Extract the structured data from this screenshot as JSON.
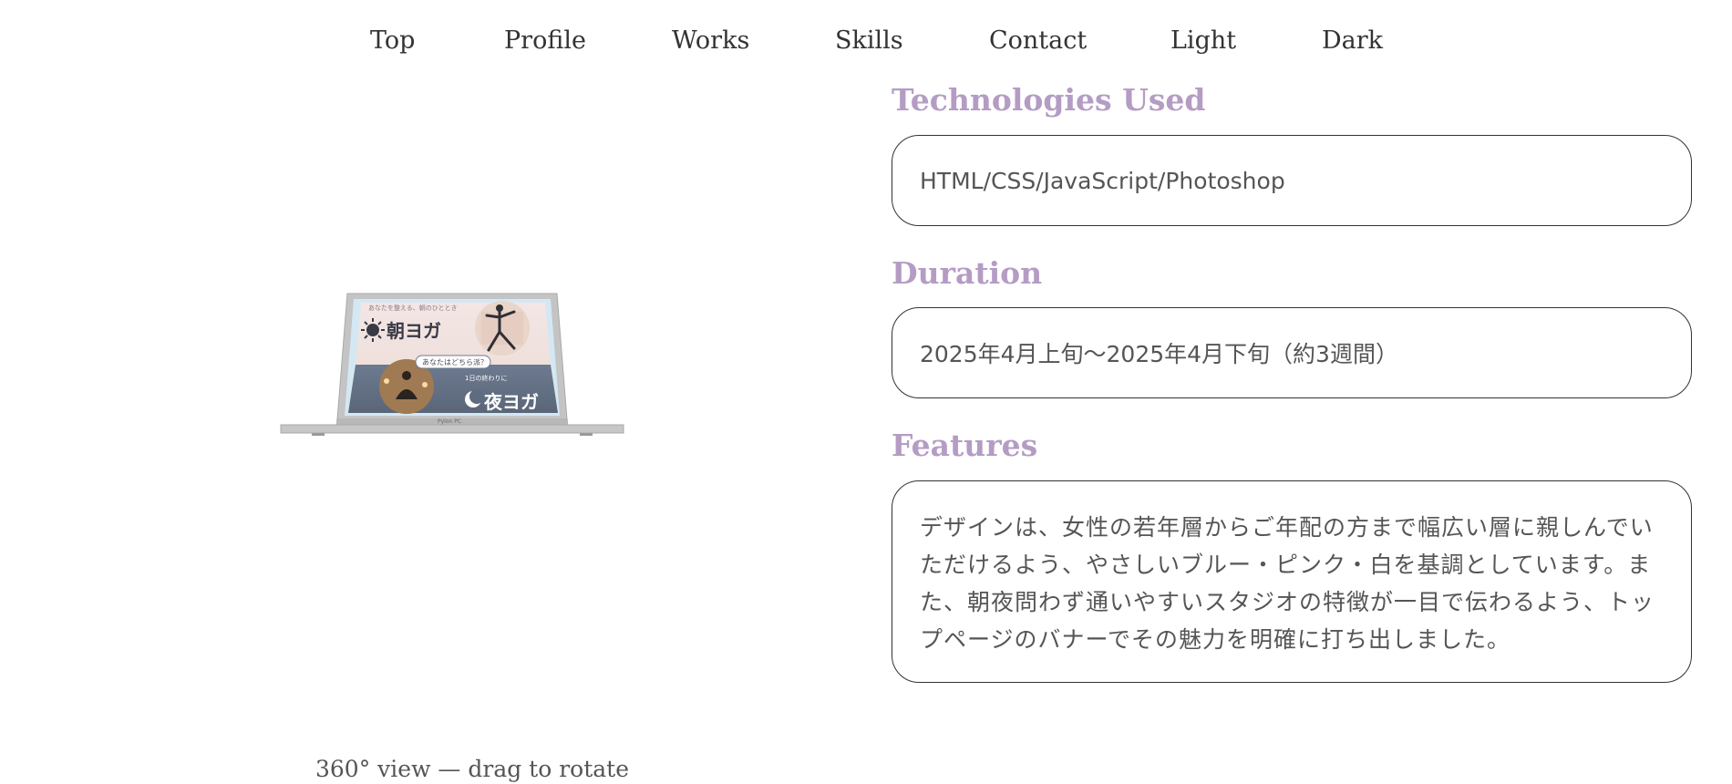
{
  "nav": {
    "items": [
      "Top",
      "Profile",
      "Works",
      "Skills",
      "Contact",
      "Light",
      "Dark"
    ]
  },
  "viewer": {
    "caption": "360° view — drag to rotate",
    "laptop_brand": "Pylon PC",
    "screen": {
      "top_tag": "あなたを整える、朝のひととき",
      "morning_title": "朝ヨガ",
      "middle_tag": "あなたはどちら派？",
      "bottom_tag": "1日の終わりに",
      "night_title": "夜ヨガ"
    }
  },
  "details": {
    "tech_title": "Technologies Used",
    "tech_value": "HTML/CSS/JavaScript/Photoshop",
    "duration_title": "Duration",
    "duration_value": "2025年4月上旬〜2025年4月下旬（約3週間）",
    "features_title": "Features",
    "features_value": "デザインは、女性の若年層からご年配の方まで幅広い層に親しんでいただけるよう、やさしいブルー・ピンク・白を基調としています。また、朝夜問わず通いやすいスタジオの特徴が一目で伝わるよう、トップページのバナーでその魅力を明確に打ち出しました。"
  },
  "colors": {
    "accent": "#b49cc4",
    "text": "#333333",
    "muted": "#555555",
    "border": "#333333"
  }
}
